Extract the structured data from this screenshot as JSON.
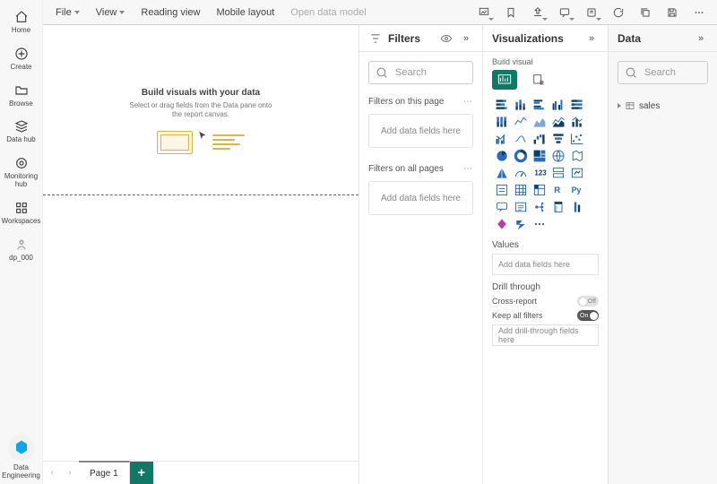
{
  "rail": {
    "items": [
      {
        "label": "Home",
        "icon": "home"
      },
      {
        "label": "Create",
        "icon": "plus-circle"
      },
      {
        "label": "Browse",
        "icon": "folder"
      },
      {
        "label": "Data hub",
        "icon": "stack"
      },
      {
        "label": "Monitoring hub",
        "icon": "target"
      },
      {
        "label": "Workspaces",
        "icon": "grid"
      },
      {
        "label": "dp_000",
        "icon": "avatar"
      }
    ],
    "bottom": {
      "label": "Data Engineering",
      "icon": "persona"
    }
  },
  "toolbar": {
    "file": "File",
    "view": "View",
    "reading": "Reading view",
    "mobile": "Mobile layout",
    "model": "Open data model"
  },
  "canvas": {
    "empty_title": "Build visuals with your data",
    "empty_sub": "Select or drag fields from the Data pane onto the report canvas."
  },
  "tabs": {
    "first": "Page 1"
  },
  "filters": {
    "title": "Filters",
    "search_placeholder": "Search",
    "page": "Filters on this page",
    "all": "Filters on all pages",
    "drop": "Add data fields here"
  },
  "viz": {
    "title": "Visualizations",
    "subtitle": "Build visual",
    "types": [
      "stacked-bar",
      "stacked-column",
      "clustered-bar",
      "clustered-column",
      "100-stacked-bar",
      "100-stacked-column",
      "line",
      "area",
      "stacked-area",
      "line-stacked-column",
      "line-clustered-column",
      "ribbon",
      "waterfall",
      "funnel",
      "scatter",
      "pie",
      "donut",
      "treemap",
      "map",
      "filled-map",
      "azure-map",
      "gauge",
      "card",
      "multi-row-card",
      "kpi",
      "slicer",
      "table",
      "matrix",
      "r-script",
      "python",
      "qa",
      "narrative",
      "decomposition",
      "paginated",
      "key-influencers",
      "power-apps",
      "power-automate",
      "more"
    ],
    "values_title": "Values",
    "values_drop": "Add data fields here",
    "drill_title": "Drill through",
    "cross": "Cross-report",
    "cross_state": "Off",
    "keep": "Keep all filters",
    "keep_state": "On",
    "drill_drop": "Add drill-through fields here"
  },
  "data": {
    "title": "Data",
    "search_placeholder": "Search",
    "tables": [
      {
        "name": "sales"
      }
    ]
  }
}
